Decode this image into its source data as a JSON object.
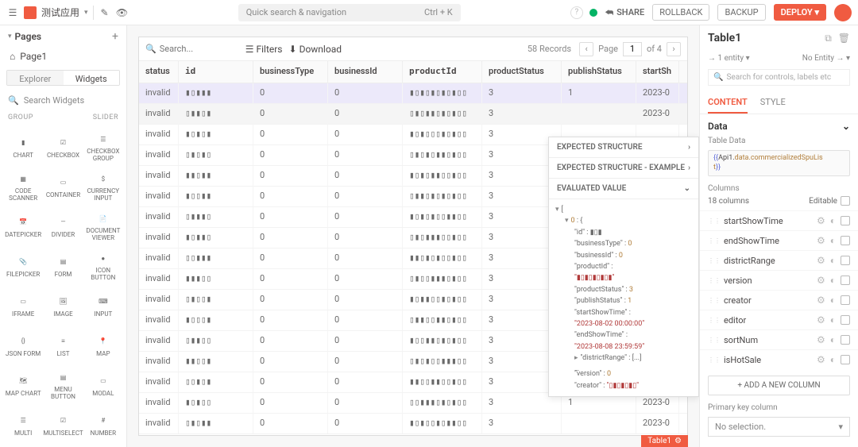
{
  "topbar": {
    "app_title": "测试应用",
    "omnibox_placeholder": "Quick search & navigation",
    "omnibox_hint": "Ctrl + K",
    "share": "SHARE",
    "rollback": "ROLLBACK",
    "backup": "BACKUP",
    "deploy": "DEPLOY"
  },
  "pages": {
    "title": "Pages",
    "page1": "Page1"
  },
  "explorer_tabs": {
    "explorer": "Explorer",
    "widgets": "Widgets"
  },
  "search_widgets_placeholder": "Search Widgets",
  "cat": {
    "group": "GROUP",
    "slider": "SLIDER"
  },
  "widgets": [
    "CHART",
    "CHECKBOX",
    "CHECKBOX GROUP",
    "CODE SCANNER",
    "CONTAINER",
    "CURRENCY INPUT",
    "DATEPICKER",
    "DIVIDER",
    "DOCUMENT VIEWER",
    "FILEPICKER",
    "FORM",
    "ICON BUTTON",
    "IFRAME",
    "IMAGE",
    "INPUT",
    "JSON FORM",
    "LIST",
    "MAP",
    "MAP CHART",
    "MENU BUTTON",
    "MODAL",
    "MULTI",
    "MULTISELECT",
    "NUMBER"
  ],
  "table_toolbar": {
    "search_placeholder": "Search...",
    "filters": "Filters",
    "download": "Download",
    "records": "58 Records",
    "page_label": "Page",
    "page_current": "1",
    "page_total": "of 4"
  },
  "columns": [
    "status",
    "id",
    "businessType",
    "businessId",
    "productId",
    "productStatus",
    "publishStatus",
    "startSh"
  ],
  "rows": [
    {
      "status": "invalid",
      "id": "▮▯▮▮▮",
      "bt": "0",
      "bi": "0",
      "pid": "▮▯▮▯▮▯▮▯▮▯▯",
      "ps": "3",
      "pub": "1",
      "start": "2023-0",
      "sel": true
    },
    {
      "status": "invalid",
      "id": "▯▮▮▯▮",
      "bt": "0",
      "bi": "0",
      "pid": "▯▮▯▮▮▯▮▯▮▯▯",
      "ps": "3",
      "pub": "",
      "start": "2023-0",
      "hover": true
    },
    {
      "status": "invalid",
      "id": "▮▯▮▯▮",
      "bt": "0",
      "bi": "0",
      "pid": "▮▯▮▯▯▯▮▯▮▯▯",
      "ps": "3",
      "pub": "",
      "start": ""
    },
    {
      "status": "invalid",
      "id": "▯▮▯▮▯",
      "bt": "0",
      "bi": "0",
      "pid": "▯▮▯▮▯▮▮▯▮▯▯",
      "ps": "3",
      "pub": "",
      "start": ""
    },
    {
      "status": "invalid",
      "id": "▮▮▯▮▮",
      "bt": "0",
      "bi": "0",
      "pid": "▮▯▮▯▮▮▯▯▮▯▯",
      "ps": "3",
      "pub": "",
      "start": ""
    },
    {
      "status": "invalid",
      "id": "▮▯▯▮▮",
      "bt": "0",
      "bi": "0",
      "pid": "▯▮▮▯▮▯▮▯▮▯▯",
      "ps": "3",
      "pub": "",
      "start": ""
    },
    {
      "status": "invalid",
      "id": "▯▮▮▮▯",
      "bt": "0",
      "bi": "0",
      "pid": "▮▯▮▯▮▯▯▮▮▯▯",
      "ps": "3",
      "pub": "",
      "start": ""
    },
    {
      "status": "invalid",
      "id": "▮▯▮▮▯",
      "bt": "0",
      "bi": "0",
      "pid": "▯▮▯▮▮▮▯▯▮▯▯",
      "ps": "3",
      "pub": "",
      "start": ""
    },
    {
      "status": "invalid",
      "id": "▯▯▮▮▮",
      "bt": "0",
      "bi": "0",
      "pid": "▮▮▯▮▯▮▯▯▮▯▯",
      "ps": "3",
      "pub": "",
      "start": ""
    },
    {
      "status": "invalid",
      "id": "▮▮▮▯▯",
      "bt": "0",
      "bi": "0",
      "pid": "▯▮▯▯▮▮▮▯▮▯▯",
      "ps": "3",
      "pub": "",
      "start": ""
    },
    {
      "status": "invalid",
      "id": "▯▮▯▯▮",
      "bt": "0",
      "bi": "0",
      "pid": "▮▯▮▮▯▯▮▯▮▯▯",
      "ps": "3",
      "pub": "",
      "start": ""
    },
    {
      "status": "invalid",
      "id": "▮▯▯▯▮",
      "bt": "0",
      "bi": "0",
      "pid": "▯▮▮▯▯▮▮▯▮▯▯",
      "ps": "3",
      "pub": "",
      "start": ""
    },
    {
      "status": "invalid",
      "id": "▯▮▮▯▯",
      "bt": "0",
      "bi": "0",
      "pid": "▮▯▯▮▮▯▮▯▮▯▯",
      "ps": "3",
      "pub": "",
      "start": ""
    },
    {
      "status": "invalid",
      "id": "▮▮▯▯▮",
      "bt": "0",
      "bi": "0",
      "pid": "▯▮▯▮▯▯▮▮▮▯▯",
      "ps": "3",
      "pub": "",
      "start": ""
    },
    {
      "status": "invalid",
      "id": "▯▯▮▯▮",
      "bt": "0",
      "bi": "0",
      "pid": "▮▮▯▯▮▮▯▯▮▯▯",
      "ps": "3",
      "pub": "",
      "start": ""
    },
    {
      "status": "invalid",
      "id": "▮▯▮▯▯",
      "bt": "0",
      "bi": "0",
      "pid": "▯▯▮▮▮▯▮▯▮▯▯",
      "ps": "3",
      "pub": "1",
      "start": "2023-0"
    },
    {
      "status": "invalid",
      "id": "▯▮▯▮▮",
      "bt": "0",
      "bi": "0",
      "pid": "▮▯▮▯▯▮▯▮▮▯▯",
      "ps": "3",
      "pub": "",
      "start": "2023-0"
    }
  ],
  "widget_tag": "Table1",
  "eval": {
    "s1": "EXPECTED STRUCTURE",
    "s2": "EXPECTED STRUCTURE - EXAMPLE",
    "s3": "EVALUATED VALUE",
    "obj": {
      "idx": "0",
      "id_k": "\"id\"",
      "id_v": "▮▯▮",
      "bt_k": "\"businessType\"",
      "bt_v": "0",
      "bi_k": "\"businessId\"",
      "bi_v": "0",
      "pid_k": "\"productId\"",
      "pid_v": "\"▮▯▮▯▮▯▮▯▮\"",
      "ps_k": "\"productStatus\"",
      "ps_v": "3",
      "pub_k": "\"publishStatus\"",
      "pub_v": "1",
      "sst_k": "\"startShowTime\"",
      "sst_v": "\"2023-08-02 00:00:00\"",
      "est_k": "\"endShowTime\"",
      "est_v": "\"2023-08-08 23:59:59\"",
      "dr_k": "\"districtRange\"",
      "dr_v": "[...]",
      "ver_k": "\"version\"",
      "ver_v": "0",
      "cr_k": "\"creator\"",
      "cr_v": "\"▯▮▯▮▯▮▯\""
    }
  },
  "right": {
    "title": "Table1",
    "entity_left": "→ 1 entity",
    "entity_right": "No Entity →",
    "search_placeholder": "Search for controls, labels etc",
    "tab_content": "CONTENT",
    "tab_style": "STYLE",
    "section_data": "Data",
    "label_table_data": "Table Data",
    "code_p1": "{{",
    "code_p2": "Api1.",
    "code_p3": "data.commercializedSpuLis",
    "code_p4": "t",
    "code_p5": "}}",
    "columns_label": "Columns",
    "columns_count": "18 columns",
    "editable": "Editable",
    "cols": [
      "startShowTime",
      "endShowTime",
      "districtRange",
      "version",
      "creator",
      "editor",
      "sortNum",
      "isHotSale"
    ],
    "add_col": "+ ADD A NEW COLUMN",
    "pk_label": "Primary key column",
    "pk_value": "No selection."
  }
}
